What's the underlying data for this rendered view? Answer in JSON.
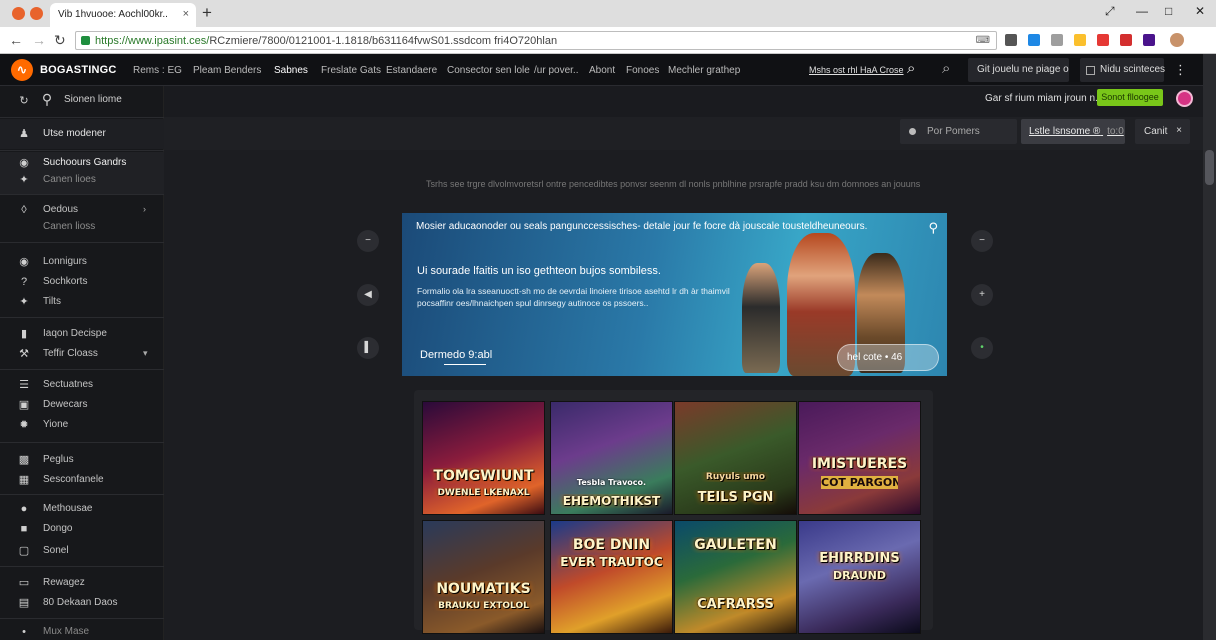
{
  "browser": {
    "tab_title": "Vib 1hvuooe: Aochl00kr..",
    "url_prefix": "https://www.ipasint.ces/",
    "url_rest": "RCzmiere/7800/0121001-1.1818/b631164fvwS01.ssdcom fri4O720hlan",
    "omnibox_ext": "⌨",
    "new_tab": "+",
    "close_tab": "×",
    "back": "←",
    "forward": "→",
    "reload": "↻",
    "win_restore": "⤢",
    "win_min": "—",
    "win_max": "□",
    "win_close": "✕",
    "ext_colors": [
      "#555555",
      "#1e88e5",
      "#9e9e9e",
      "#fbc02d",
      "#e53935",
      "#d32f2f",
      "#4a148c"
    ]
  },
  "header": {
    "logo": "BOGASTINGC",
    "logo_mark": "∿",
    "nav": [
      {
        "label": "Rems : EG"
      },
      {
        "label": "Pleam Benders"
      },
      {
        "label": "Sabnes"
      },
      {
        "label": "Freslate Gats"
      },
      {
        "label": "Estandaere"
      },
      {
        "label": "Consector sen lole"
      },
      {
        "label": "/ur pover.."
      },
      {
        "label": "Abont"
      },
      {
        "label": "Fonoes"
      },
      {
        "label": "Mechler grathep"
      }
    ],
    "active_nav": "Sabnes",
    "link": "Mshs ost rhl HaA Crose",
    "search_icon": "⌕",
    "btn_signup": "Git jouelu ne piage o",
    "btn_settings": "Nidu scinteces",
    "kebab": "⋮"
  },
  "subheader": {
    "text": "Gar sf rium miam jroun n..",
    "green_button": "Sonot flloogee"
  },
  "sidebar": {
    "search_label": "Sionen liome",
    "items": [
      {
        "label": "Utse modener",
        "icon": "user-icon"
      },
      {
        "label": "Suchoours Gandrs",
        "icon": "globe-icon"
      },
      {
        "label": "Canen lioes",
        "icon": "share-icon",
        "sub": true
      },
      {
        "label": "Oedous",
        "icon": "diamond-icon",
        "arrow": "›"
      },
      {
        "label": "Canen lioss",
        "icon": "",
        "sub": true
      },
      {
        "label": "Lonnigurs",
        "icon": "gamepad-icon"
      },
      {
        "label": "Sochkorts",
        "icon": "help-icon"
      },
      {
        "label": "Tilts",
        "icon": "sparkle-icon"
      },
      {
        "label": "Iaqon Decispe",
        "icon": "bars-icon"
      },
      {
        "label": "Teffir Cloass",
        "icon": "tools-icon",
        "arrow": "▾"
      },
      {
        "label": "Sectuatnes",
        "icon": "list-icon"
      },
      {
        "label": "Dewecars",
        "icon": "box-icon"
      },
      {
        "label": "Yione",
        "icon": "star-icon"
      },
      {
        "label": "Peglus",
        "icon": "chart-icon"
      },
      {
        "label": "Sesconfanele",
        "icon": "grid-icon"
      },
      {
        "label": "Methousae",
        "icon": "circle-icon"
      },
      {
        "label": "Dongo",
        "icon": "square-icon"
      },
      {
        "label": "Sonel",
        "icon": "frame-icon"
      },
      {
        "label": "Rewagez",
        "icon": "tag-icon"
      },
      {
        "label": "80 Dekaan Daos",
        "icon": "doc-icon"
      },
      {
        "label": "Mux Mase",
        "icon": "lock-icon"
      }
    ]
  },
  "filters": {
    "field1": "Por Pomers",
    "field2": "Lstle lsnsome ®",
    "field2_suffix": "to:0",
    "cancel": "Canit",
    "cancel_x": "×"
  },
  "promo_note": "Tsrhs see trgre dlvolmvoretsrl ontre pencedibtes ponvsr seenm dl nonls pnblhine prsrapfe pradd ksu dm domnoes an jouuns",
  "banner": {
    "top": "Mosier aducaonoder ou seals pangunccessisches- detale jour fe focre dà jouscale tousteldheuneours.",
    "headline": "Ui sourade lfaitis un iso gethteon bujos sombiless.",
    "body": "Formalio ola lra sseanuoctt-sh mo de oevrdai linoiere tirisoe asehtd lr dh àr thaimvil pocsaffinr oes/lhnaichpen spul dinrsegy autinoce os pssoers..",
    "cta": "Dermedo 9:abl",
    "pill_text": "hel cote",
    "pill_num": "• 46"
  },
  "controls": {
    "left": [
      "−",
      "◀",
      "▌"
    ],
    "right": [
      "−",
      "+",
      "•"
    ]
  },
  "games": [
    {
      "title": "TOMGWIUNT",
      "sub": "DWENLE LKENAXL",
      "bg": "linear-gradient(160deg,#2a0a3a 0%,#8a1c3c 45%,#e0642a 80%,#3a0c12 100%)"
    },
    {
      "title": "EHEMOTHIKST",
      "sub": "Tesbla Travoco.",
      "bg": "linear-gradient(160deg,#3a2a6a 0%,#6c3c8c 40%,#3a7c5c 75%,#1a1a2a 100%)"
    },
    {
      "title": "TEILS PGN",
      "sub": "Ruyuls umo",
      "bg": "linear-gradient(160deg,#7a3a2a 0%,#3a5a2a 45%,#2a3a1a 80%,#140c08 100%)"
    },
    {
      "title": "IMISTUERES",
      "sub": "COT PARGON",
      "bg": "linear-gradient(160deg,#4a1a5a 0%,#6a2a6a 40%,#8a3a3a 75%,#2a0a2a 100%)"
    },
    {
      "title": "NOUMATIKS",
      "sub": "BRAUKU EXTOLOL",
      "bg": "linear-gradient(160deg,#2a3a5a 0%,#5a3a2a 45%,#8a5a2a 80%,#1a1010 100%)"
    },
    {
      "title": "BOE DNIN",
      "sub": "EVER TRAUTOC",
      "bg": "linear-gradient(160deg,#1a3a8a 0%,#c04a2a 45%,#e0a02a 75%,#3a1a0a 100%)"
    },
    {
      "title": "GAULETEN",
      "sub": "CAFRARSS",
      "bg": "linear-gradient(160deg,#0a4a6a 0%,#2a6a3a 40%,#c08a2a 75%,#2a1a0a 100%)"
    },
    {
      "title": "EHIRRDINS",
      "sub": "DRAUND",
      "bg": "linear-gradient(160deg,#3a3a8a 0%,#6a6ab0 40%,#3a2a5a 75%,#0a0a1a 100%)"
    }
  ]
}
